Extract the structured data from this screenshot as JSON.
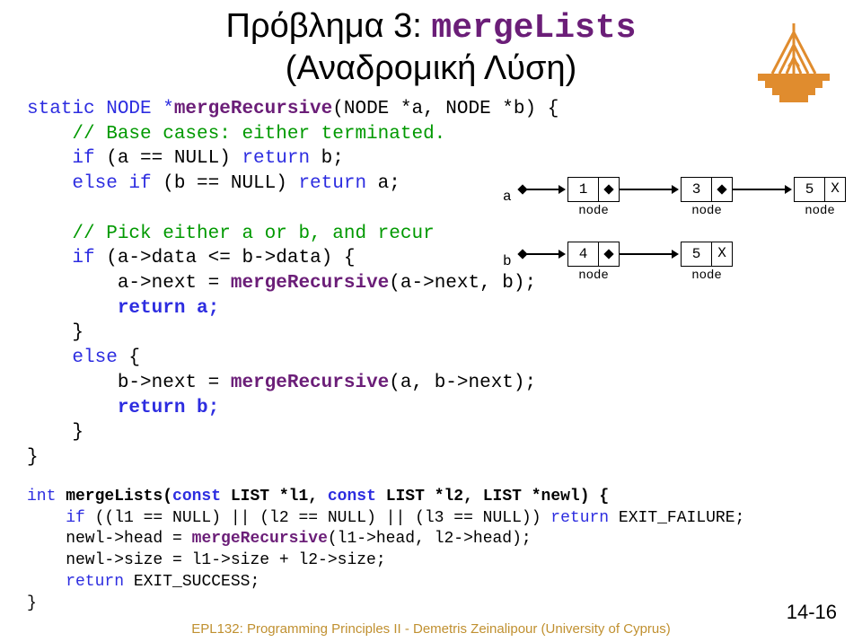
{
  "title": {
    "line1_greek": "Πρόβλημα 3: ",
    "line1_code": "mergeLists",
    "line2": "(Αναδρομική Λύση)"
  },
  "code": {
    "l1_a": "static NODE *",
    "l1_b": "mergeRecursive",
    "l1_c": "(NODE *a, NODE *b) {",
    "l2": "    // Base cases: either terminated.",
    "l3_a": "    if",
    "l3_b": " (a == NULL) ",
    "l3_c": "return",
    "l3_d": " b;",
    "l4_a": "    else if",
    "l4_b": " (b == NULL) ",
    "l4_c": "return",
    "l4_d": " a;",
    "l5": "",
    "l6": "    // Pick either a or b, and recur",
    "l7_a": "    if",
    "l7_b": " (a->data <= b->data) {",
    "l8_a": "        a->next = ",
    "l8_b": "mergeRecursive",
    "l8_c": "(a->next, b);",
    "l9_a": "        return a;",
    "l10": "    }",
    "l11_a": "    else",
    "l11_b": " {",
    "l12_a": "        b->next = ",
    "l12_b": "mergeRecursive",
    "l12_c": "(a, b->next);",
    "l13_a": "        return b;",
    "l14": "    }",
    "l15": "}"
  },
  "code2": {
    "l1_a": "int",
    "l1_b": " mergeLists(",
    "l1_c": "const",
    "l1_d": " LIST *l1, ",
    "l1_e": "const",
    "l1_f": " LIST *l2, LIST *newl) {",
    "l2_a": "    if",
    "l2_b": " ((l1 == NULL) || (l2 == NULL) || (l3 == NULL)) ",
    "l2_c": "return",
    "l2_d": " EXIT_FAILURE;",
    "l3_a": "    newl->head = ",
    "l3_b": "mergeRecursive",
    "l3_c": "(l1->head, l2->head);",
    "l4": "    newl->size = l1->size + l2->size;",
    "l5_a": "    return",
    "l5_b": " EXIT_SUCCESS;",
    "l6": "}"
  },
  "diagram": {
    "a_label": "a",
    "b_label": "b",
    "node_label": "node",
    "row_a": [
      "1",
      "3",
      "5"
    ],
    "row_b": [
      "4",
      "5"
    ],
    "null_mark": "X"
  },
  "footer": "EPL132: Programming Principles II - Demetris Zeinalipour (University of Cyprus)",
  "page": "14-16"
}
